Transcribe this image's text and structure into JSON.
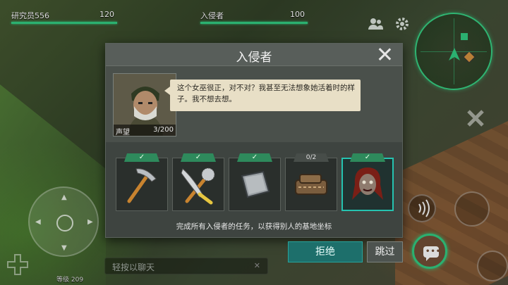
{
  "hud": {
    "player": {
      "name": "研究员556",
      "value": "120"
    },
    "invader": {
      "name": "入侵者",
      "value": "100"
    },
    "level": "等级 209"
  },
  "chat": {
    "placeholder": "轻按以聊天"
  },
  "dialog": {
    "title": "入侵者",
    "portrait": {
      "name": "声望",
      "score": "3/200"
    },
    "speech": "这个女巫很正，对不对？我甚至无法想象她活着时的样子。我不想去想。",
    "tasks": [
      {
        "status": "✓",
        "icon": "pickaxe-icon"
      },
      {
        "status": "✓",
        "icon": "axe-saw-icon"
      },
      {
        "status": "✓",
        "icon": "metal-plate-icon"
      },
      {
        "status": "0/2",
        "icon": "gear-parts-icon"
      },
      {
        "status": "✓",
        "icon": "zombie-head-icon"
      }
    ],
    "hint": "完成所有入侵者的任务，以获得别人的基地坐标",
    "reject_label": "拒绝",
    "skip_label": "跳过"
  },
  "colors": {
    "accent": "#2fbf7a",
    "dialog_bg": "#3e4440",
    "speech_bg": "#e8dfc6",
    "reject_btn": "#1d6f6b",
    "active_task_border": "#25c3b0"
  }
}
